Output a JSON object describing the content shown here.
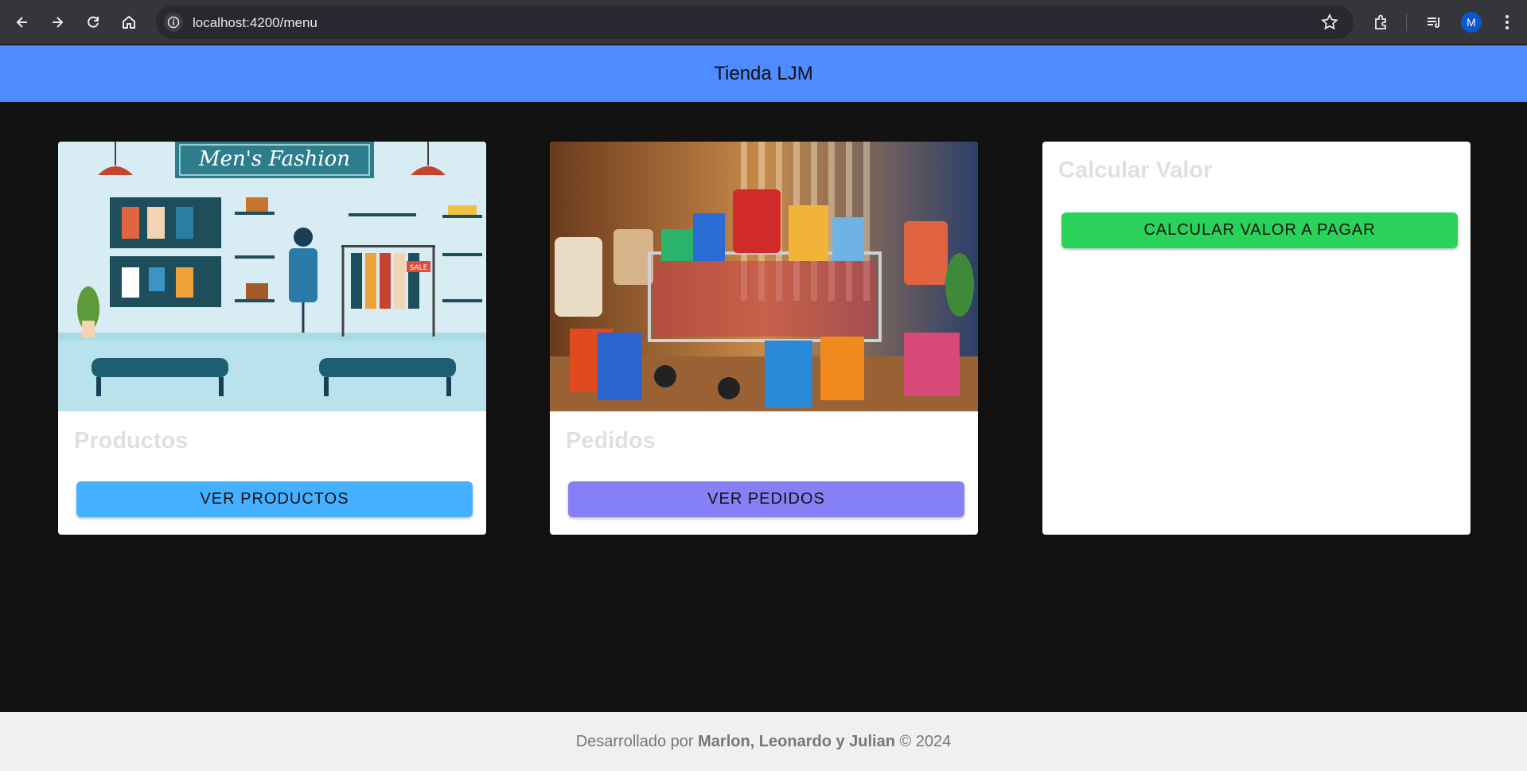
{
  "browser": {
    "url": "localhost:4200/menu",
    "profile_initial": "M",
    "icons": [
      "back-arrow-icon",
      "forward-arrow-icon",
      "reload-icon",
      "home-icon",
      "site-info-icon",
      "bookmark-star-icon",
      "extensions-icon",
      "reading-list-icon",
      "kebab-menu-icon"
    ]
  },
  "header": {
    "title": "Tienda LJM",
    "background": "#4e8cff"
  },
  "cards": [
    {
      "title": "Productos",
      "image_alt": "Men's Fashion",
      "image_banner_text": "Men's Fashion",
      "image_sale_tag": "SALE",
      "button_label": "VER PRODUCTOS",
      "button_color": "#45b0ff"
    },
    {
      "title": "Pedidos",
      "image_alt": "Shopping cart with bags",
      "button_label": "VER PEDIDOS",
      "button_color": "#8680f7"
    },
    {
      "title": "Calcular Valor",
      "button_label": "CALCULAR VALOR A PAGAR",
      "button_color": "#2bd25a"
    }
  ],
  "footer": {
    "prefix": "Desarrollado por",
    "authors": "Marlon, Leonardo y Julian",
    "suffix": "© 2024"
  }
}
